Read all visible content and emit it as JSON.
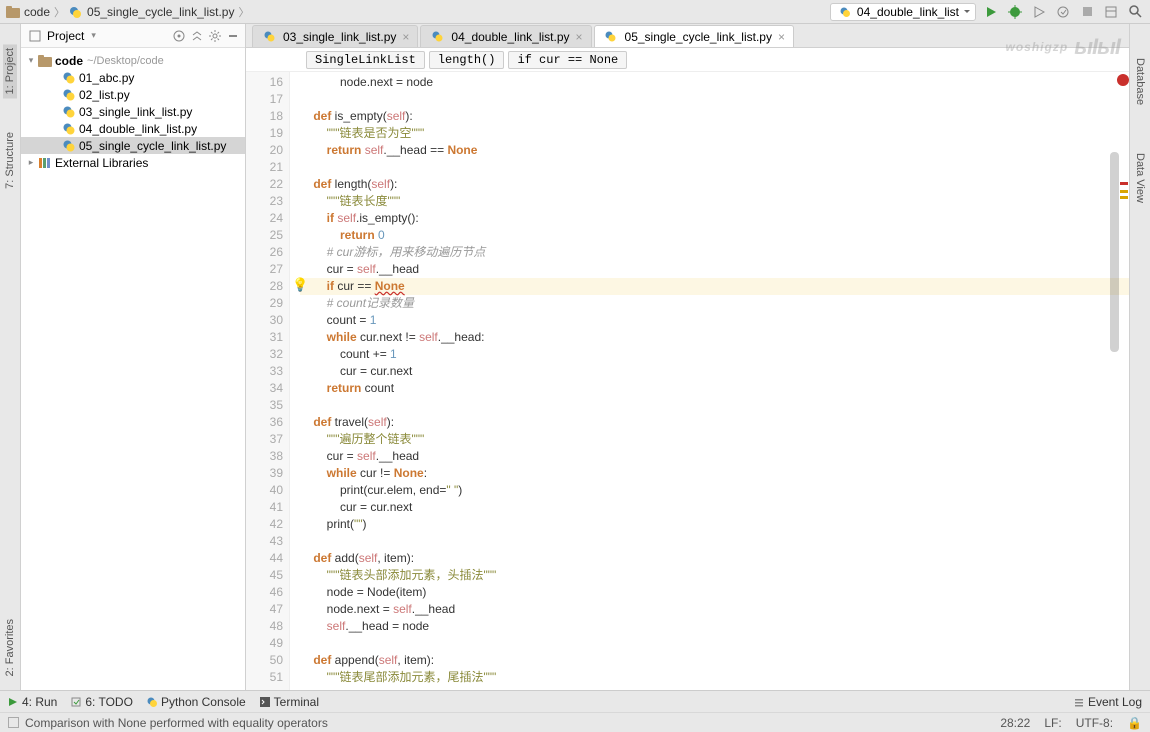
{
  "topbar": {
    "root": "code",
    "file": "05_single_cycle_link_list.py",
    "run_config": "04_double_link_list"
  },
  "project": {
    "title": "Project",
    "root_name": "code",
    "root_path": "~/Desktop/code",
    "files": [
      "01_abc.py",
      "02_list.py",
      "03_single_link_list.py",
      "04_double_link_list.py",
      "05_single_cycle_link_list.py"
    ],
    "libs": "External Libraries"
  },
  "tabs": [
    {
      "label": "03_single_link_list.py"
    },
    {
      "label": "04_double_link_list.py"
    },
    {
      "label": "05_single_cycle_link_list.py",
      "active": true
    }
  ],
  "breadcrumbs": [
    "SingleLinkList",
    "length()",
    "if cur == None"
  ],
  "code": {
    "start": 16,
    "lines": [
      {
        "t": "            node.next = node"
      },
      {
        "t": ""
      },
      {
        "t": "    def is_empty(self):",
        "d": true
      },
      {
        "t": "        \"\"\"链表是否为空\"\"\"",
        "s": true
      },
      {
        "t": "        return self.__head == None",
        "r": true
      },
      {
        "t": ""
      },
      {
        "t": "    def length(self):",
        "d": true
      },
      {
        "t": "        \"\"\"链表长度\"\"\"",
        "s": true
      },
      {
        "t": "        if self.is_empty():",
        "iff": true
      },
      {
        "t": "            return 0",
        "r0": true
      },
      {
        "t": "        # cur游标，用来移动遍历节点",
        "c": true
      },
      {
        "t": "        cur = self.__head"
      },
      {
        "t": "        if cur == None",
        "hl": true,
        "ifn": true
      },
      {
        "t": "        # count记录数量",
        "c": true
      },
      {
        "t": "        count = 1",
        "n1": true
      },
      {
        "t": "        while cur.next != self.__head:",
        "wh": true
      },
      {
        "t": "            count += 1",
        "n1b": true
      },
      {
        "t": "            cur = cur.next"
      },
      {
        "t": "        return count",
        "rc": true
      },
      {
        "t": ""
      },
      {
        "t": "    def travel(self):",
        "d": true
      },
      {
        "t": "        \"\"\"遍历整个链表\"\"\"",
        "s": true
      },
      {
        "t": "        cur = self.__head"
      },
      {
        "t": "        while cur != None:",
        "whn": true
      },
      {
        "t": "            print(cur.elem, end=\" \")",
        "pr": true
      },
      {
        "t": "            cur = cur.next"
      },
      {
        "t": "        print(\"\")",
        "pr2": true
      },
      {
        "t": ""
      },
      {
        "t": "    def add(self, item):",
        "d": true
      },
      {
        "t": "        \"\"\"链表头部添加元素，头插法\"\"\"",
        "s": true
      },
      {
        "t": "        node = Node(item)"
      },
      {
        "t": "        node.next = self.__head"
      },
      {
        "t": "        self.__head = node"
      },
      {
        "t": ""
      },
      {
        "t": "    def append(self, item):",
        "d": true
      },
      {
        "t": "        \"\"\"链表尾部添加元素，尾插法\"\"\"",
        "s": true,
        "cut": true
      }
    ]
  },
  "left_tabs": [
    "1: Project",
    "7: Structure",
    "2: Favorites"
  ],
  "right_tabs": [
    "Database",
    "Data View"
  ],
  "bottom": {
    "run": "4: Run",
    "todo": "6: TODO",
    "console": "Python Console",
    "terminal": "Terminal",
    "eventlog": "Event Log"
  },
  "status": {
    "msg": "Comparison with None performed with equality operators",
    "pos": "28:22",
    "sep": "LF:",
    "enc": "UTF-8:",
    "lock": "🔒"
  },
  "watermark": {
    "name": "woshigzp"
  }
}
